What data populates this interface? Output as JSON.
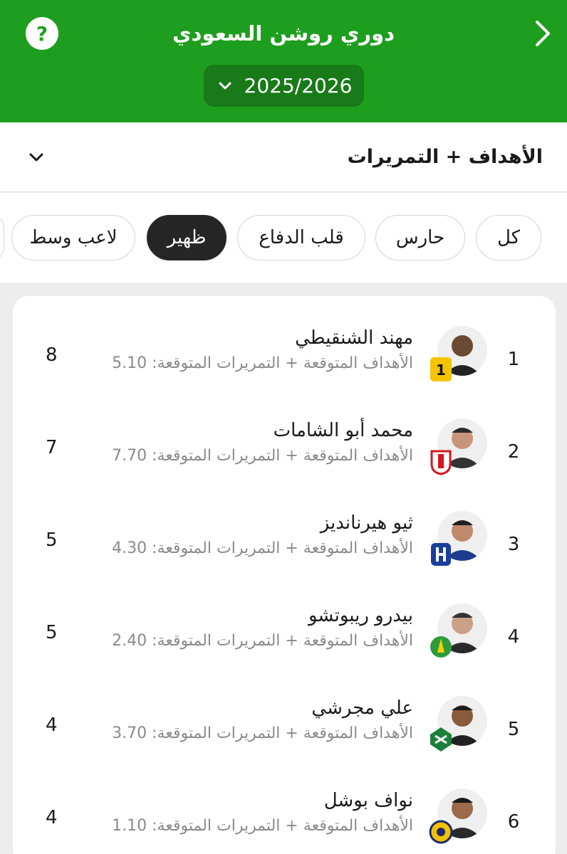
{
  "header": {
    "title": "دوري روشن السعودي",
    "season": "2025/2026",
    "help_icon": "question-icon",
    "back_icon": "chevron-right-icon",
    "colors": {
      "primary": "#1e9e1e",
      "season_bg": "#187a18"
    }
  },
  "stat_selector": {
    "label": "الأهداف + التمريرات"
  },
  "filters": [
    "كل",
    "حارس",
    "قلب الدفاع",
    "ظهير",
    "لاعب وسط"
  ],
  "active_filter": "ظهير",
  "players": [
    {
      "rank": "1",
      "name": "مهند الشنقيطي",
      "metric_label": "الأهداف المتوقعة + التمريرات المتوقعة:",
      "metric_value": "5.10",
      "points": "8",
      "club": "Ittihad",
      "badge_color": "#f5c300"
    },
    {
      "rank": "2",
      "name": "محمد أبو الشامات",
      "metric_label": "الأهداف المتوقعة + التمريرات المتوقعة:",
      "metric_value": "7.70",
      "points": "7",
      "club": "Al Qadsiah",
      "badge_color": "#d6171e"
    },
    {
      "rank": "3",
      "name": "ثيو هيرنانديز",
      "metric_label": "الأهداف المتوقعة + التمريرات المتوقعة:",
      "metric_value": "4.30",
      "points": "5",
      "club": "Al Hilal",
      "badge_color": "#1a3e9c"
    },
    {
      "rank": "4",
      "name": "بيدرو ريبوتشو",
      "metric_label": "الأهداف المتوقعة + التمريرات المتوقعة:",
      "metric_value": "2.40",
      "points": "5",
      "club": "Al Khaleej",
      "badge_color": "#2e9b3a"
    },
    {
      "rank": "5",
      "name": "علي مجرشي",
      "metric_label": "الأهداف المتوقعة + التمريرات المتوقعة:",
      "metric_value": "3.70",
      "points": "4",
      "club": "Al Ahli",
      "badge_color": "#1d7f3c"
    },
    {
      "rank": "6",
      "name": "نواف بوشل",
      "metric_label": "الأهداف المتوقعة + التمريرات المتوقعة:",
      "metric_value": "1.10",
      "points": "4",
      "club": "Al Nassr",
      "badge_color": "#f2c200"
    }
  ]
}
